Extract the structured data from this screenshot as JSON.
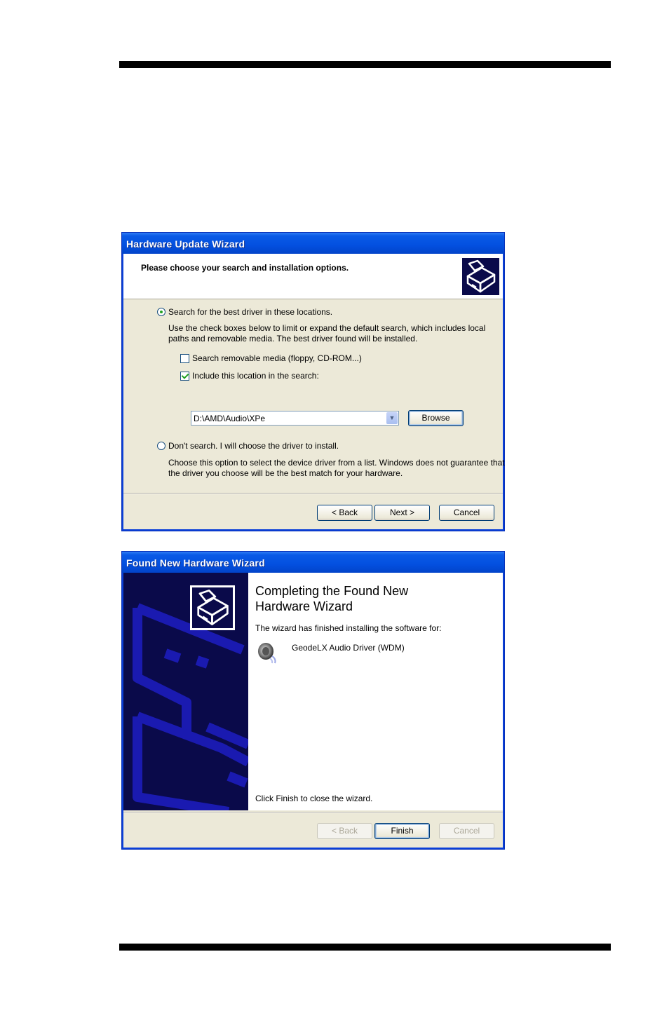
{
  "page": {
    "top_rule": "decorative-rule",
    "bottom_rule": "decorative-rule"
  },
  "hardware_update_wizard": {
    "title": "Hardware Update Wizard",
    "header_title": "Please choose your search and installation options.",
    "header_icon": "hardware-wizard-icon",
    "option_search": {
      "label": "Search for the best driver in these locations.",
      "selected": true,
      "description": "Use the check boxes below to limit or expand the default search, which includes local paths and removable media. The best driver found will be installed."
    },
    "checkbox_removable": {
      "label": "Search removable media (floppy, CD-ROM...)",
      "checked": false
    },
    "checkbox_location": {
      "label": "Include this location in the search:",
      "checked": true
    },
    "location_combo": {
      "value": "D:\\AMD\\Audio\\XPe"
    },
    "browse_label": "Browse",
    "option_dont_search": {
      "label": "Don't search. I will choose the driver to install.",
      "selected": false,
      "description": "Choose this option to select the device driver from a list.  Windows does not guarantee that the driver you choose will be the best match for your hardware."
    },
    "buttons": {
      "back": "< Back",
      "next": "Next >",
      "cancel": "Cancel"
    }
  },
  "found_new_hardware_wizard": {
    "title": "Found New Hardware Wizard",
    "heading": "Completing the Found New Hardware Wizard",
    "intro": "The wizard has finished installing the software for:",
    "device_icon": "speaker-icon",
    "device_name": "GeodeLX Audio Driver (WDM)",
    "closing": "Click Finish to close the wizard.",
    "buttons": {
      "back": "< Back",
      "finish": "Finish",
      "cancel": "Cancel"
    },
    "back_enabled": false,
    "cancel_enabled": false
  }
}
